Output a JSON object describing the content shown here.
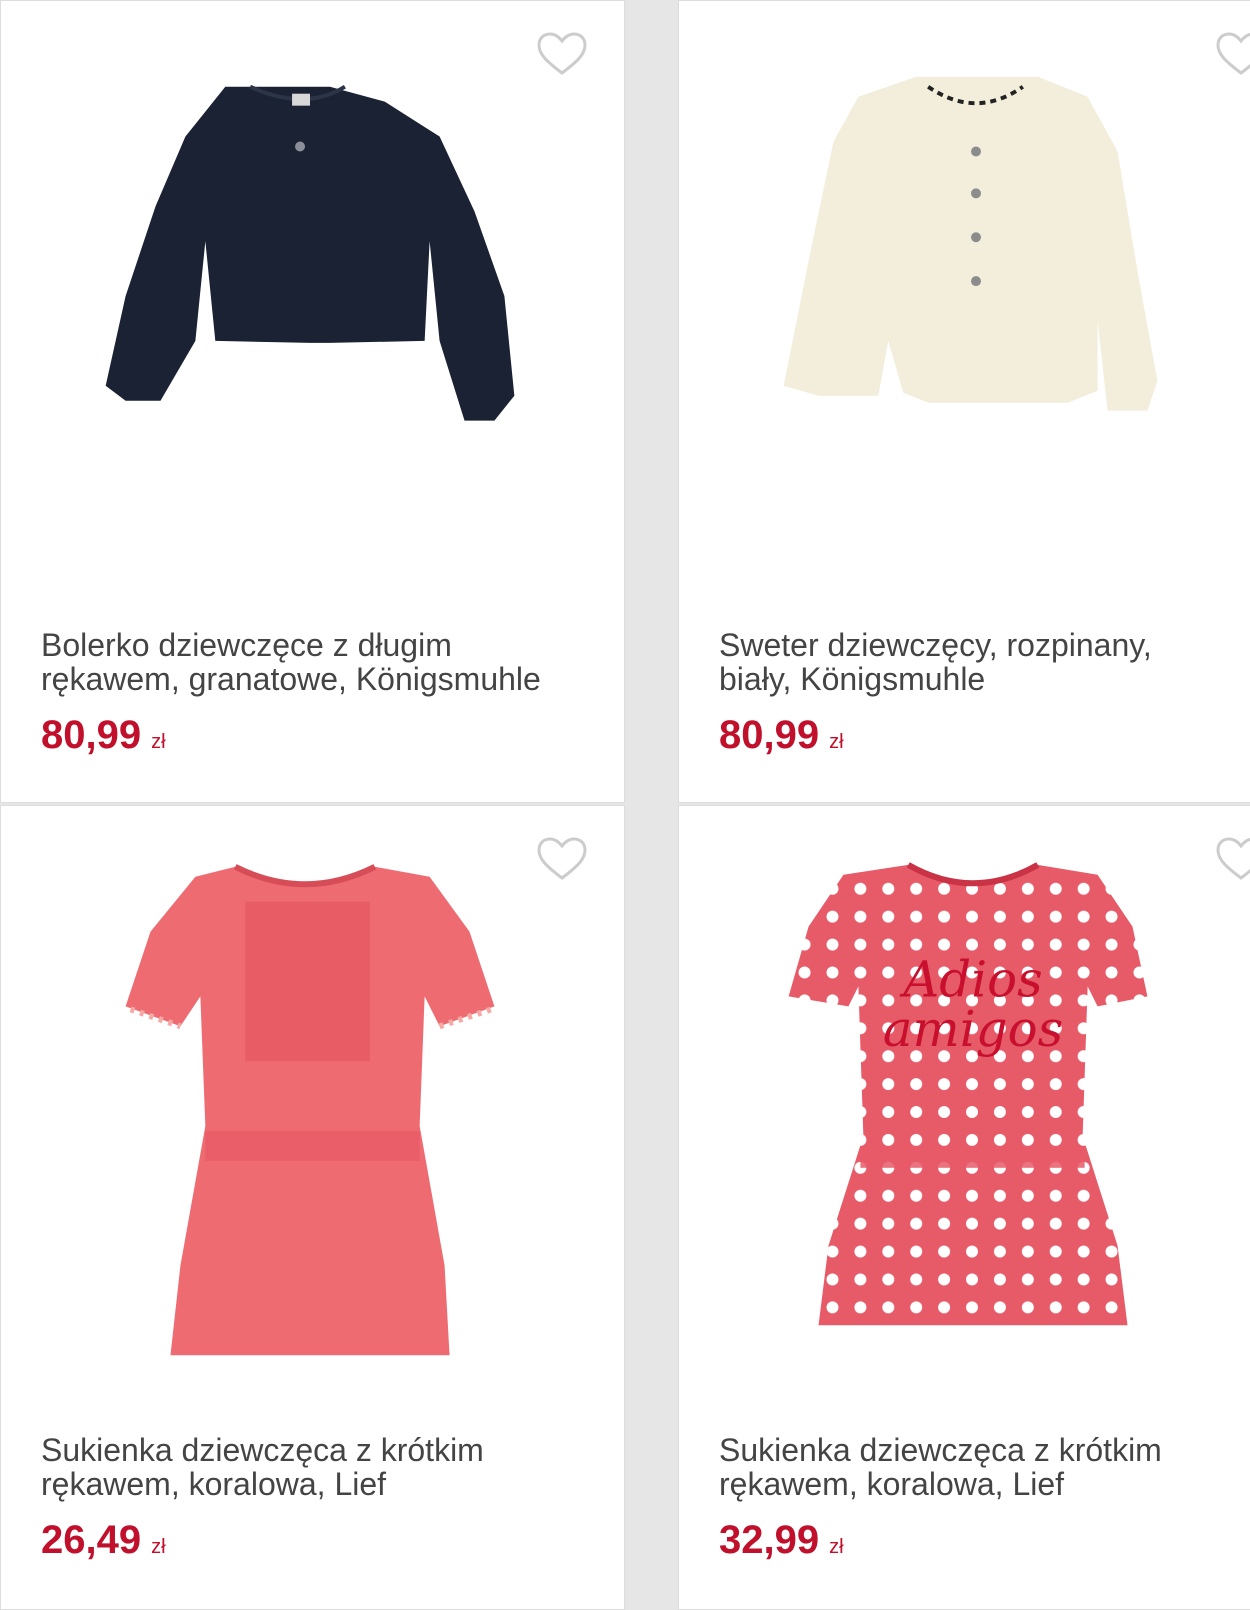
{
  "products": [
    {
      "title_line1": "Bolerko dziewczęce z długim",
      "title_line2": "rękawem, granatowe, Königsmuhle",
      "price": "80,99",
      "currency": "zł"
    },
    {
      "title_line1": "Sweter dziewczęcy, rozpinany,",
      "title_line2": "biały, Königsmuhle",
      "price": "80,99",
      "currency": "zł"
    },
    {
      "title_line1": "Sukienka dziewczęca z krótkim",
      "title_line2": "rękawem, koralowa, Lief",
      "price": "26,49",
      "currency": "zł"
    },
    {
      "title_line1": "Sukienka dziewczęca z krótkim",
      "title_line2": "rękawem, koralowa, Lief",
      "price": "32,99",
      "currency": "zł",
      "print_text": [
        "Adios",
        "amigos"
      ]
    }
  ],
  "icons": {
    "favorite": "heart-outline-icon"
  },
  "colors": {
    "price": "#c0102c",
    "title": "#444444",
    "heart": "#cccccc"
  }
}
